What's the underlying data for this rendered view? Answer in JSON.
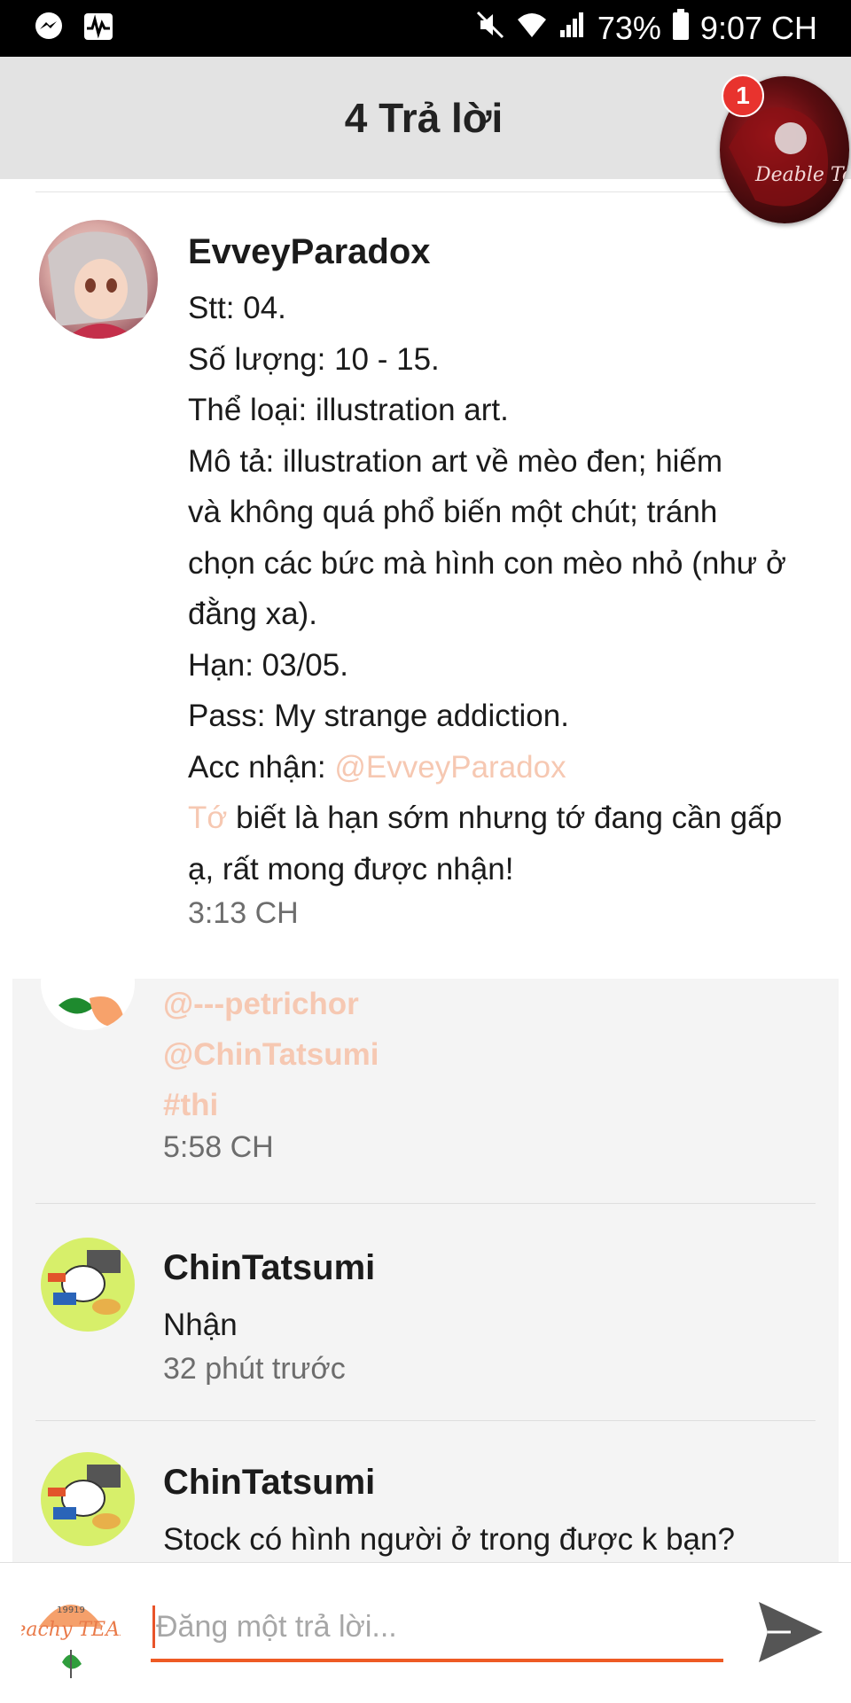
{
  "status_bar": {
    "battery": "73%",
    "time": "9:07 CH",
    "icons": [
      "messenger-icon",
      "activity-icon",
      "mute-icon",
      "wifi-icon",
      "signal-icon",
      "battery-icon"
    ]
  },
  "header": {
    "title": "4 Trả lời",
    "chat_head_badge": "1",
    "chat_head_text": "Deable Team"
  },
  "post": {
    "author": "EvveyParadox",
    "lines": [
      "Stt: 04.",
      "Số lượng: 10 - 15.",
      "Thể loại: illustration art.",
      "Mô tả: illustration art về mèo đen; hiếm",
      "và không quá phổ biến một chút; tránh",
      "chọn các bức mà hình con mèo nhỏ (như ở",
      "đằng xa).",
      "Hạn: 03/05.",
      "Pass: My strange addiction."
    ],
    "acc_label": "Acc nhận: ",
    "acc_mention": "@EvveyParadox",
    "note_mention": "Tớ",
    "note_rest": " biết là hạn sớm nhưng tớ đang cần gấp",
    "note_line2": "ạ, rất mong được nhận!",
    "time": "3:13 CH"
  },
  "replies": [
    {
      "mentions": [
        "@---petrichor",
        "@ChinTatsumi",
        "#thi"
      ],
      "time": "5:58 CH"
    },
    {
      "author": "ChinTatsumi",
      "message": "Nhận",
      "time": "32 phút trước"
    },
    {
      "author": "ChinTatsumi",
      "message": "Stock có hình người ở trong được k bạn?"
    }
  ],
  "composer": {
    "placeholder": "Đăng một trả lời...",
    "avatar_text": "Peachy TEAM",
    "avatar_year": "19919"
  },
  "colors": {
    "accent": "#ee5a24",
    "mention": "#f6c8b2",
    "header_bg": "#e3e3e3",
    "reply_bg": "#f4f4f4"
  }
}
